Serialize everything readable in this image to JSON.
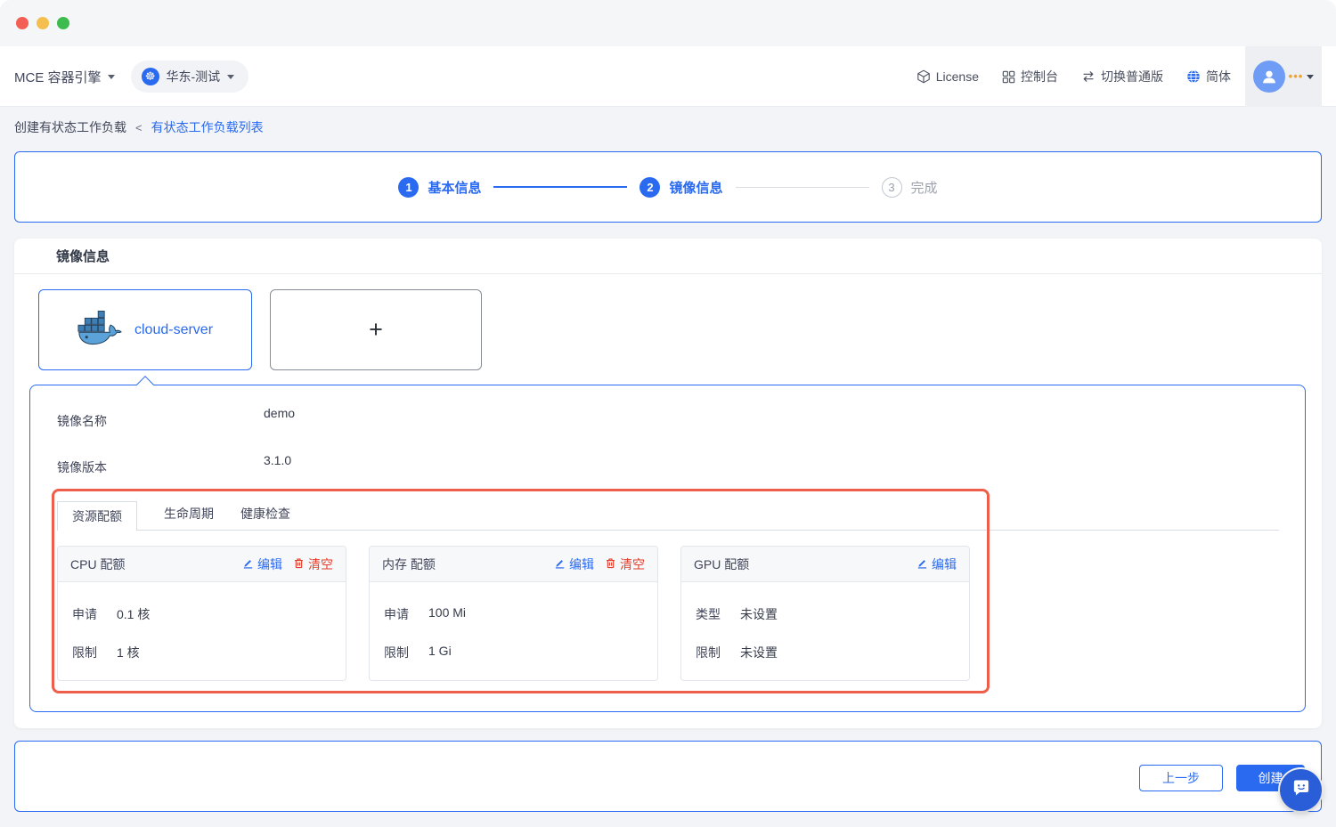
{
  "header": {
    "product_label": "MCE 容器引擎",
    "cluster_label": "华东-测试",
    "nav": [
      {
        "label": "License",
        "icon": "license-cube-icon"
      },
      {
        "label": "控制台",
        "icon": "console-grid-icon"
      },
      {
        "label": "切换普通版",
        "icon": "switch-version-icon"
      },
      {
        "label": "简体",
        "icon": "language-globe-icon"
      }
    ]
  },
  "breadcrumb": {
    "current": "创建有状态工作负载",
    "separator": "<",
    "parent": "有状态工作负载列表"
  },
  "stepper": {
    "steps": [
      {
        "num": "1",
        "label": "基本信息",
        "state": "done"
      },
      {
        "num": "2",
        "label": "镜像信息",
        "state": "active"
      },
      {
        "num": "3",
        "label": "完成",
        "state": "pending"
      }
    ]
  },
  "image_section": {
    "title": "镜像信息",
    "selected_image": "cloud-server",
    "add_button": "+",
    "fields": [
      {
        "label": "镜像名称",
        "value": "demo"
      },
      {
        "label": "镜像版本",
        "value": "3.1.0"
      }
    ],
    "tabs": [
      {
        "label": "资源配额",
        "active": true
      },
      {
        "label": "生命周期",
        "active": false
      },
      {
        "label": "健康检查",
        "active": false
      }
    ],
    "quota_cards": [
      {
        "title": "CPU 配额",
        "edit": "编辑",
        "clear": "清空",
        "rows": [
          {
            "label": "申请",
            "value": "0.1 核"
          },
          {
            "label": "限制",
            "value": "1 核"
          }
        ]
      },
      {
        "title": "内存 配额",
        "edit": "编辑",
        "clear": "清空",
        "rows": [
          {
            "label": "申请",
            "value": "100 Mi"
          },
          {
            "label": "限制",
            "value": "1 Gi"
          }
        ]
      },
      {
        "title": "GPU 配额",
        "edit": "编辑",
        "rows": [
          {
            "label": "类型",
            "value": "未设置"
          },
          {
            "label": "限制",
            "value": "未设置"
          }
        ]
      }
    ]
  },
  "footer": {
    "prev": "上一步",
    "create": "创建"
  },
  "colors": {
    "primary": "#2A6AF0",
    "danger_text": "#E33E2B",
    "highlight_border": "#ED5F4B",
    "avatar_bg": "#6F9CF4",
    "dots_orange": "#F2A32C"
  }
}
